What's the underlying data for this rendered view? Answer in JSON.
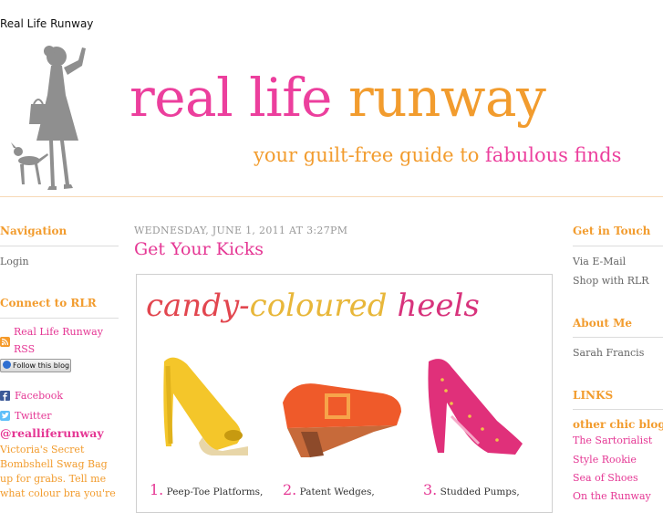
{
  "site": {
    "title": "Real Life Runway",
    "logo_part1": "real life",
    "logo_part2": "runway",
    "tagline_part1": "your guilt-free guide to",
    "tagline_part2": "fabulous finds"
  },
  "left_sidebar": {
    "navigation_heading": "Navigation",
    "login_label": "Login",
    "connect_heading": "Connect to RLR",
    "rss_title": "Real Life Runway",
    "rss_label": "RSS",
    "follow_button": "Follow this blog",
    "facebook_label": "Facebook",
    "twitter_label": "Twitter",
    "twitter_handle": "@realliferunway",
    "tweet_text": "Victoria's Secret Bombshell Swag Bag up for grabs. Tell me what colour bra you're"
  },
  "post": {
    "date": "WEDNESDAY, JUNE 1, 2011 AT 3:27PM",
    "title": "Get Your Kicks",
    "image_title_part1": "candy-",
    "image_title_part2": "coloured",
    "image_title_part3": "heels",
    "shoes": [
      {
        "number": "1.",
        "label": "Peep-Toe Platforms,"
      },
      {
        "number": "2.",
        "label": "Patent Wedges,"
      },
      {
        "number": "3.",
        "label": "Studded Pumps,"
      }
    ]
  },
  "right_sidebar": {
    "get_in_touch_heading": "Get in Touch",
    "email_label": "Via E-Mail",
    "shop_label": "Shop with RLR",
    "about_heading": "About Me",
    "about_name": "Sarah Francis",
    "links_heading": "LINKS",
    "other_blogs_heading": "other chic blogs",
    "blogs": [
      "The Sartorialist",
      "Style Rookie",
      "Sea of Shoes",
      "On the Runway"
    ]
  },
  "colors": {
    "pink": "#ec3f9d",
    "orange": "#f29c2e",
    "silhouette": "#8f8f8f"
  }
}
